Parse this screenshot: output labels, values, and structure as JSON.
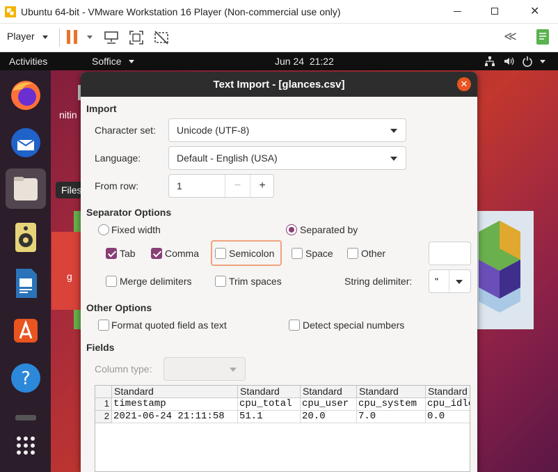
{
  "window": {
    "title": "Ubuntu 64-bit - VMware Workstation 16 Player (Non-commercial use only)"
  },
  "toolbar": {
    "player_label": "Player"
  },
  "topbar": {
    "activities": "Activities",
    "app_menu": "Soffice",
    "clock": "Jun 24  21:22"
  },
  "desktop": {
    "icon_label_partial": "nitin",
    "tooltip": "Files",
    "partial_letter": "g"
  },
  "dialog": {
    "title": "Text Import - [glances.csv]",
    "import": {
      "heading": "Import",
      "charset_label": "Character set:",
      "charset_value": "Unicode (UTF-8)",
      "language_label": "Language:",
      "language_value": "Default - English (USA)",
      "fromrow_label": "From row:",
      "fromrow_value": "1",
      "minus": "−",
      "plus": "+"
    },
    "separator": {
      "heading": "Separator Options",
      "fixed_width": "Fixed width",
      "separated_by": "Separated by",
      "tab": "Tab",
      "comma": "Comma",
      "semicolon": "Semicolon",
      "space": "Space",
      "other": "Other",
      "merge": "Merge delimiters",
      "trim": "Trim spaces",
      "string_delim_label": "String delimiter:",
      "string_delim_value": "\""
    },
    "other_options": {
      "heading": "Other Options",
      "format_quoted": "Format quoted field as text",
      "detect_special": "Detect special numbers"
    },
    "fields": {
      "heading": "Fields",
      "column_type_label": "Column type:",
      "headers": [
        "Standard",
        "Standard",
        "Standard",
        "Standard",
        "Standard"
      ],
      "row_numbers": [
        "1",
        "2"
      ],
      "rows": [
        [
          "timestamp",
          "cpu_total",
          "cpu_user",
          "cpu_system",
          "cpu_idle"
        ],
        [
          "2021-06-24 21:11:58",
          "51.1",
          "20.0",
          "7.0",
          "0.0"
        ]
      ]
    }
  },
  "colors": {
    "accent": "#8a3f74",
    "close": "#e95420",
    "dialog_header": "#2d2d2d"
  }
}
